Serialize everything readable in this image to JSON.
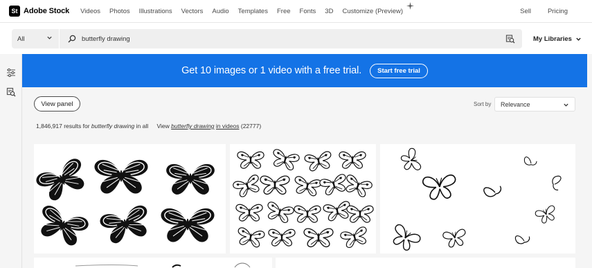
{
  "brand": {
    "mark": "St",
    "name": "Adobe Stock"
  },
  "nav": {
    "links": [
      "Videos",
      "Photos",
      "Illustrations",
      "Vectors",
      "Audio",
      "Templates",
      "Free",
      "Fonts",
      "3D",
      "Customize (Preview)"
    ],
    "right": [
      "Sell",
      "Pricing"
    ]
  },
  "search": {
    "filter": "All",
    "query": "butterfly drawing",
    "libraries": "My Libraries"
  },
  "banner": {
    "text": "Get 10 images or 1 video with a free trial.",
    "button": "Start free trial",
    "color": "#1473e6"
  },
  "controls": {
    "view_panel": "View panel",
    "sort_label": "Sort by",
    "sort_value": "Relevance"
  },
  "results": {
    "count": "1,846,917",
    "mid": "results for",
    "term": "butterfly drawing",
    "scope": "in all",
    "view": "View",
    "video_link": "butterfly drawing",
    "video_tail": "in videos",
    "video_count": "(22777)"
  },
  "icons": [
    "sparkle-icon",
    "search-icon",
    "visual-search-icon",
    "chevron-down-icon",
    "filter-sliders-icon",
    "image-search-icon"
  ]
}
